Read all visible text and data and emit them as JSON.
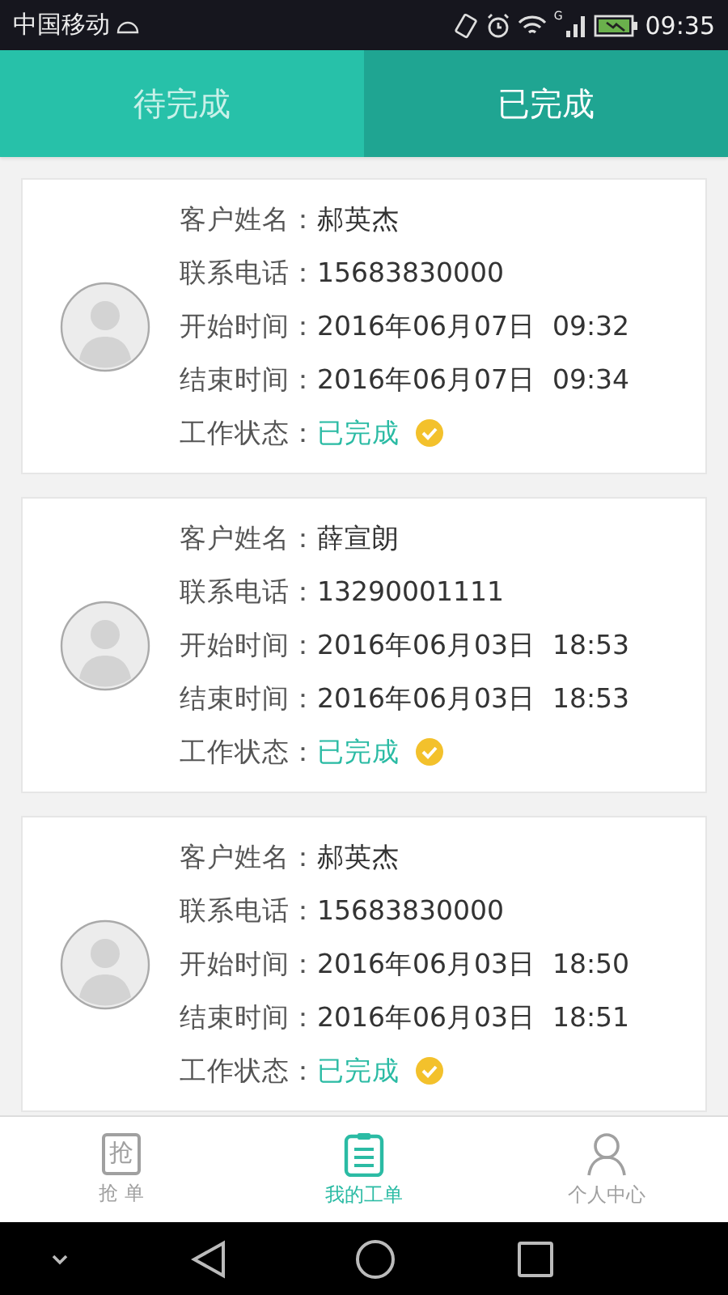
{
  "status_bar": {
    "carrier": "中国移动",
    "network": "G",
    "time": "09:35"
  },
  "tabs": [
    {
      "label": "待完成",
      "selected": false
    },
    {
      "label": "已完成",
      "selected": true
    }
  ],
  "orders": [
    {
      "fields": [
        {
          "label": "客户姓名：",
          "value": "郝英杰"
        },
        {
          "label": "联系电话：",
          "value": "15683830000"
        },
        {
          "label": "开始时间：",
          "value": "2016年06月07日  09:32"
        },
        {
          "label": "结束时间：",
          "value": "2016年06月07日  09:34"
        }
      ],
      "status": {
        "label": "工作状态：",
        "value": "已完成",
        "done": true
      }
    },
    {
      "fields": [
        {
          "label": "客户姓名：",
          "value": "薛宣朗"
        },
        {
          "label": "联系电话：",
          "value": "13290001111"
        },
        {
          "label": "开始时间：",
          "value": "2016年06月03日  18:53"
        },
        {
          "label": "结束时间：",
          "value": "2016年06月03日  18:53"
        }
      ],
      "status": {
        "label": "工作状态：",
        "value": "已完成",
        "done": true
      }
    },
    {
      "fields": [
        {
          "label": "客户姓名：",
          "value": "郝英杰"
        },
        {
          "label": "联系电话：",
          "value": "15683830000"
        },
        {
          "label": "开始时间：",
          "value": "2016年06月03日  18:50"
        },
        {
          "label": "结束时间：",
          "value": "2016年06月03日  18:51"
        }
      ],
      "status": {
        "label": "工作状态：",
        "value": "已完成",
        "done": true
      }
    }
  ],
  "bottom_nav": [
    {
      "kind": "grab",
      "icon_text": "抢",
      "label": "抢 单",
      "selected": false
    },
    {
      "kind": "orders",
      "label": "我的工单",
      "selected": true
    },
    {
      "kind": "profile",
      "label": "个人中心",
      "selected": false
    }
  ]
}
